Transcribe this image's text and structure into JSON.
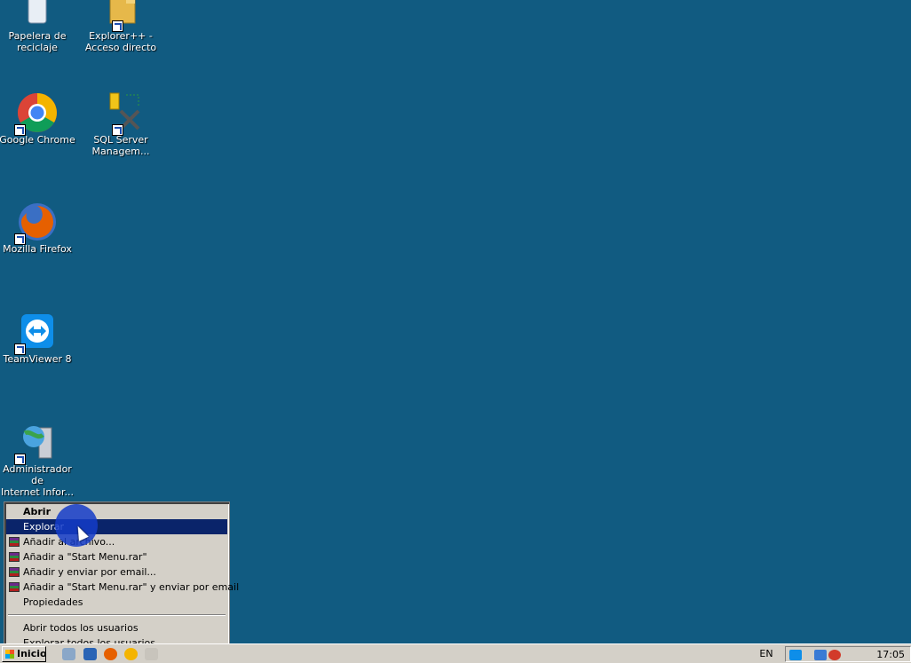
{
  "desktop": {
    "icons": [
      {
        "label": "Papelera de\nreciclaje",
        "icon": "recycle-bin-icon"
      },
      {
        "label": "Explorer++ -\nAcceso directo",
        "icon": "folder-icon"
      },
      {
        "label": "Google Chrome",
        "icon": "chrome-icon"
      },
      {
        "label": "SQL Server\nManagem...",
        "icon": "sql-server-icon"
      },
      {
        "label": "Mozilla Firefox",
        "icon": "firefox-icon"
      },
      {
        "label": "TeamViewer 8",
        "icon": "teamviewer-icon"
      },
      {
        "label": "Administrador de\nInternet Infor...",
        "icon": "iis-manager-icon"
      }
    ]
  },
  "context_menu": {
    "items": [
      {
        "label": "Abrir"
      },
      {
        "label": "Explorar"
      },
      {
        "label": "Añadir al archivo..."
      },
      {
        "label": "Añadir a \"Start Menu.rar\""
      },
      {
        "label": "Añadir y enviar por email..."
      },
      {
        "label": "Añadir a \"Start Menu.rar\" y enviar por email"
      },
      {
        "label": "Propiedades"
      },
      {
        "label": "Abrir todos los usuarios"
      },
      {
        "label": "Explorar todos los usuarios"
      }
    ]
  },
  "taskbar": {
    "start_label": "Inicio",
    "language": "EN",
    "clock": "17:05"
  },
  "colors": {
    "desktop": "#115b81",
    "menu_highlight": "#0a246a"
  }
}
